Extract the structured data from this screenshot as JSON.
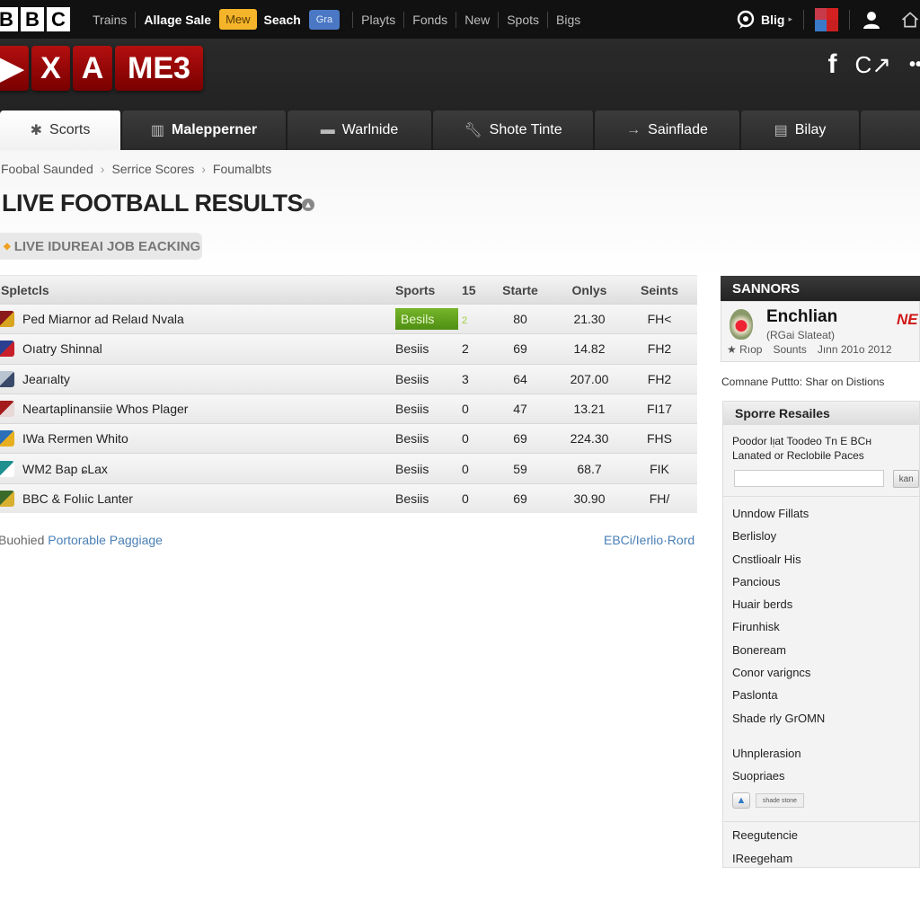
{
  "topbar": {
    "logo_letters": [
      "B",
      "B",
      "C"
    ],
    "nav": [
      {
        "label": "Trains",
        "style": "dim"
      },
      {
        "label": "Allage Sale",
        "style": "bold"
      },
      {
        "label": "Mew",
        "style": "badge-yellow"
      },
      {
        "label": "Seach",
        "style": "bold"
      },
      {
        "label": "Gra",
        "style": "badge-blue"
      },
      {
        "label": "Playts",
        "style": "dim"
      },
      {
        "label": "Fonds",
        "style": "dim"
      },
      {
        "label": "New",
        "style": "dim"
      },
      {
        "label": "Spots",
        "style": "dim"
      },
      {
        "label": "Bigs",
        "style": "dim"
      }
    ],
    "right": {
      "chat_icon": "chat-bubble-icon",
      "blig_label": "Blig",
      "blig_caret": "▸",
      "flag_icon": "region-flag-icon",
      "user_icon": "user-icon",
      "home_icon": "home-icon"
    }
  },
  "header": {
    "brand_tiles": [
      "▶",
      "X",
      "A",
      "ME3"
    ],
    "social": {
      "facebook": "f",
      "share": "C↗",
      "more": "••"
    }
  },
  "tabs": [
    {
      "label": "Scorts",
      "icon": "gear-cluster-icon",
      "active": true
    },
    {
      "label": "Malepperner",
      "icon": "building-icon",
      "active": false
    },
    {
      "label": "Warlnide",
      "icon": "folder-icon",
      "active": false
    },
    {
      "label": "Shote Tinte",
      "icon": "wrench-icon",
      "active": false
    },
    {
      "label": "Sainflade",
      "icon": "arrow-right-icon",
      "active": false
    },
    {
      "label": "Bilay",
      "icon": "clipboard-icon",
      "active": false
    },
    {
      "label": "",
      "icon": "",
      "active": false
    }
  ],
  "breadcrumb": [
    "Foobal Saunded",
    "Serrice Scores",
    "Foumalbts"
  ],
  "page": {
    "title": "LIVE FOOTBALL RESULTS",
    "live_pill": "LIVE IDUREAI JOB EACKING"
  },
  "table": {
    "columns": [
      "Spletcls",
      "Sports",
      "15",
      "Starte",
      "Onlys",
      "Seints"
    ],
    "rows": [
      {
        "team": "Ped Miarnor ad Relaıd Nvala",
        "crest_colors": [
          "#8b1a1a",
          "#d9a520"
        ],
        "sport": "Besils",
        "n": "2",
        "start": "80",
        "only": "21.30",
        "result": "FH<",
        "highlight": true
      },
      {
        "team": "Oıatry Shinnal",
        "crest_colors": [
          "#2a3f8f",
          "#c8202a"
        ],
        "sport": "Besiis",
        "n": "2",
        "start": "69",
        "only": "14.82",
        "result": "FH2",
        "highlight": false
      },
      {
        "team": "Jearıalty",
        "crest_colors": [
          "#b8c4d0",
          "#3a4a6a"
        ],
        "sport": "Besiis",
        "n": "3",
        "start": "64",
        "only": "207.00",
        "result": "FH2",
        "highlight": false
      },
      {
        "team": "Neartaplinansiie Whos Plager",
        "crest_colors": [
          "#a31b1b",
          "#e8d8d8"
        ],
        "sport": "Besiis",
        "n": "0",
        "start": "47",
        "only": "13.21",
        "result": "FI17",
        "highlight": false
      },
      {
        "team": "IWa Rermen Whito",
        "crest_colors": [
          "#2a6fb8",
          "#e8b020"
        ],
        "sport": "Besiis",
        "n": "0",
        "start": "69",
        "only": "224.30",
        "result": "FHS",
        "highlight": false
      },
      {
        "team": "WM2 Bap ɕLax",
        "crest_colors": [
          "#1f8f8f",
          "#ffffff"
        ],
        "sport": "Besiis",
        "n": "0",
        "start": "59",
        "only": "68.7",
        "result": "FIK",
        "highlight": false
      },
      {
        "team": "BBC & Folıic Lanter",
        "crest_colors": [
          "#3a6a2a",
          "#d8b030"
        ],
        "sport": "Besiis",
        "n": "0",
        "start": "69",
        "only": "30.90",
        "result": "FH/",
        "highlight": false
      }
    ]
  },
  "footer": {
    "left_prefix": "Buohied",
    "left_link": "Portorable Paggiage",
    "right_link": "EBCi/Ierlio·Rord"
  },
  "sidebar": {
    "header": "SANNORS",
    "card": {
      "title": "Enchlian",
      "subtitle": "(RGai Slateat)",
      "meta": [
        "★ Rıop",
        "Sounts",
        "Jınn 201o 2012"
      ],
      "badge": "NE"
    },
    "note": "Comnane Puttto: Shar on Distions",
    "panel": {
      "title": "Sporre Resailes",
      "desc_line1": "Poodor lᴉat Toodeo Tn E BCʜ",
      "desc_line2": "Lanated or Reclobile Paces",
      "search_value": "",
      "search_placeholder": "",
      "go_label": "kan",
      "items": [
        "Unndow Fillats",
        "Berlisloy",
        "Cnstlioalr His",
        "Pancious",
        "Huair berds",
        "Firunhisk",
        "Boneream",
        "Conor varigncs",
        "Paslonta",
        "Shade rly GrOMN",
        "Uhnplerasion",
        "Suopriaes"
      ],
      "tool_label": "shade stone",
      "items2": [
        "Reegutencie",
        "IReegeham"
      ]
    }
  }
}
